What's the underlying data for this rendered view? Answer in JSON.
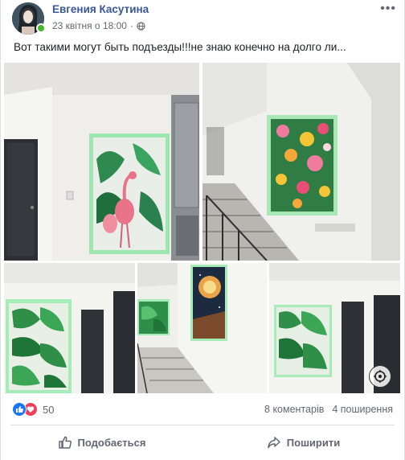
{
  "post": {
    "author": "Евгения Касутина",
    "date": "23 квітня о 18:00",
    "text": "Вот такими могут быть подъезды!!!не знаю конечно на долго ли...",
    "more_label": "•••"
  },
  "reactions": {
    "count": "50",
    "icons": [
      "like-icon",
      "love-icon"
    ]
  },
  "stats": {
    "comments": "8 коментарів",
    "shares": "4 поширення"
  },
  "actions": {
    "like": "Подобається",
    "share": "Поширити"
  },
  "colors": {
    "author": "#385898",
    "like": "#1877f2",
    "love": "#f33e58",
    "online": "#42b72a",
    "mural_frame": "#9ee6b0"
  },
  "photos": [
    "flamingo-tropical-mural",
    "tropical-flowers-mural",
    "palm-leaves-mural",
    "stairwell-murals",
    "palm-leaves-mural-door"
  ]
}
